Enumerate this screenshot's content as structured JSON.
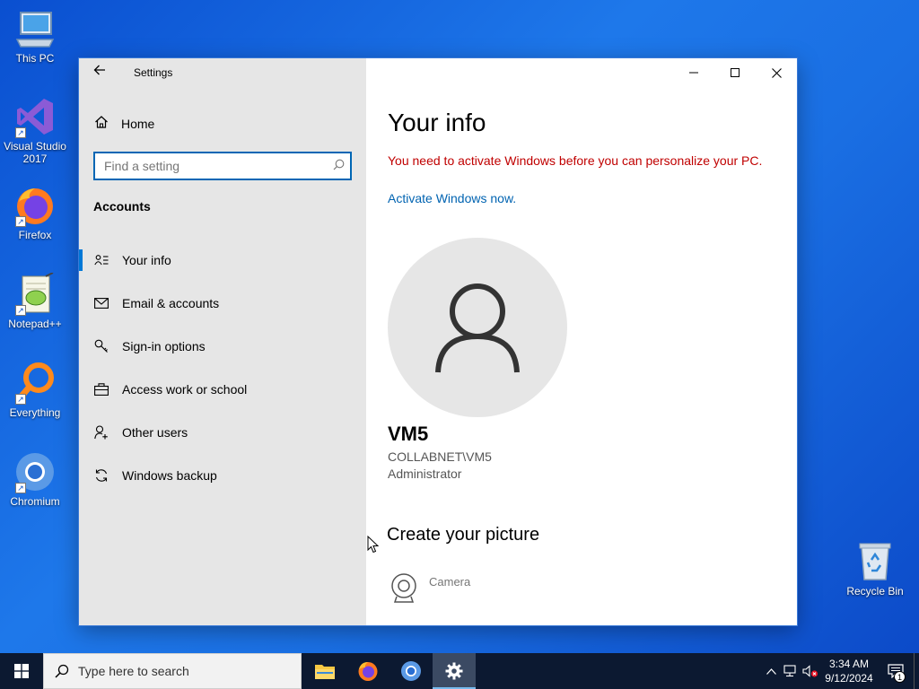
{
  "desktop": {
    "icons": [
      {
        "label": "This PC",
        "icon": "computer-icon"
      },
      {
        "label": "Visual Studio 2017",
        "icon": "visual-studio-icon"
      },
      {
        "label": "Firefox",
        "icon": "firefox-icon"
      },
      {
        "label": "Notepad++",
        "icon": "notepad-plus-plus-icon"
      },
      {
        "label": "Everything",
        "icon": "everything-search-icon"
      },
      {
        "label": "Chromium",
        "icon": "chromium-icon"
      }
    ],
    "recycle_bin": {
      "label": "Recycle Bin",
      "icon": "recycle-bin-icon"
    }
  },
  "window": {
    "title": "Settings",
    "controls": {
      "minimize": "minimize-icon",
      "maximize": "maximize-icon",
      "close": "close-icon"
    }
  },
  "sidebar": {
    "home_label": "Home",
    "search_placeholder": "Find a setting",
    "section_heading": "Accounts",
    "items": [
      {
        "label": "Your info",
        "icon": "contact-card-icon",
        "active": true
      },
      {
        "label": "Email & accounts",
        "icon": "mail-icon",
        "active": false
      },
      {
        "label": "Sign-in options",
        "icon": "key-icon",
        "active": false
      },
      {
        "label": "Access work or school",
        "icon": "briefcase-icon",
        "active": false
      },
      {
        "label": "Other users",
        "icon": "person-add-icon",
        "active": false
      },
      {
        "label": "Windows backup",
        "icon": "sync-icon",
        "active": false
      }
    ]
  },
  "main": {
    "title": "Your info",
    "activation_warning": "You need to activate Windows before you can personalize your PC.",
    "activate_link": "Activate Windows now.",
    "user": {
      "name": "VM5",
      "account": "COLLABNET\\VM5",
      "role": "Administrator"
    },
    "create_picture_heading": "Create your picture",
    "camera_label": "Camera"
  },
  "taskbar": {
    "search_placeholder": "Type here to search",
    "pinned": [
      {
        "name": "file-explorer",
        "icon": "folder-icon",
        "state": "normal"
      },
      {
        "name": "firefox",
        "icon": "firefox-icon",
        "state": "normal"
      },
      {
        "name": "chromium",
        "icon": "chromium-icon",
        "state": "normal"
      },
      {
        "name": "settings",
        "icon": "gear-icon",
        "state": "active"
      }
    ],
    "clock": {
      "time": "3:34 AM",
      "date": "9/12/2024"
    },
    "notification_count": "1"
  },
  "colors": {
    "accent": "#0078d7",
    "warning": "#c00000",
    "link": "#0063b1",
    "sidebar_bg": "#e6e6e6",
    "taskbar_bg": "#0c1931"
  }
}
